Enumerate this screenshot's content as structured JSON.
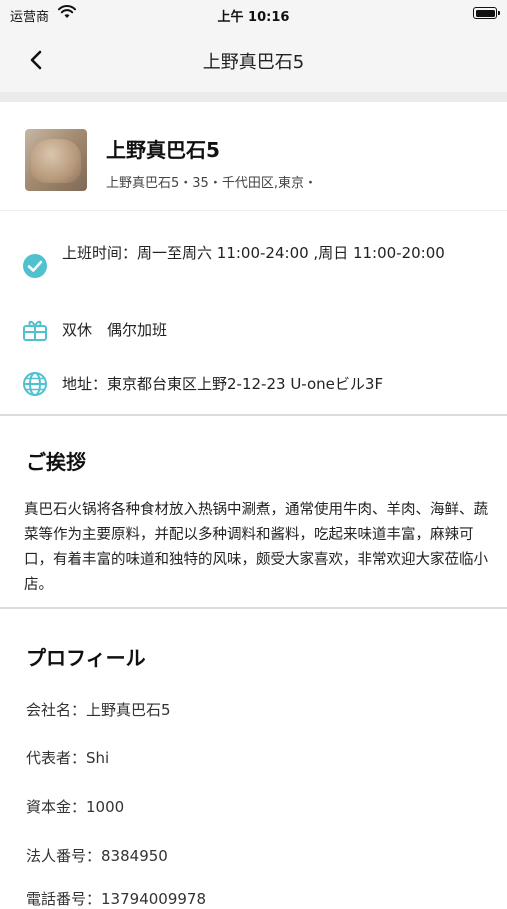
{
  "status_bar": {
    "carrier": "运营商",
    "time": "上午 10:16"
  },
  "nav": {
    "title": "上野真巴石5"
  },
  "shop": {
    "name": "上野真巴石5",
    "subtitle": "上野真巴石5・35・千代田区,東京・"
  },
  "info": {
    "hours_label": "上班时间：",
    "hours_value": "周一至周六 11:00-24:00 ,周日 11:00-20:00",
    "holiday": "双休　偶尔加班",
    "address_label": "地址：",
    "address_value": "東京都台東区上野2-12-23 U-oneビル3F"
  },
  "greeting": {
    "title": "ご挨拶",
    "body": "真巴石火锅将各种食材放入热锅中涮煮，通常使用牛肉、羊肉、海鲜、蔬菜等作为主要原料，并配以多种调料和酱料，吃起来味道丰富，麻辣可口，有着丰富的味道和独特的风味，颇受大家喜欢，非常欢迎大家莅临小店。"
  },
  "profile": {
    "title": "プロフィール",
    "rows": [
      {
        "label": "会社名：",
        "value": "上野真巴石5"
      },
      {
        "label": "代表者：",
        "value": "Shi"
      },
      {
        "label": "資本金：",
        "value": "1000"
      },
      {
        "label": "法人番号：",
        "value": "8384950"
      },
      {
        "label": "電話番号：",
        "value": "13794009978"
      }
    ]
  },
  "colors": {
    "accent": "#4fc1cf",
    "nav_bg": "#f5f5f5",
    "divider": "#dcdcdc"
  }
}
